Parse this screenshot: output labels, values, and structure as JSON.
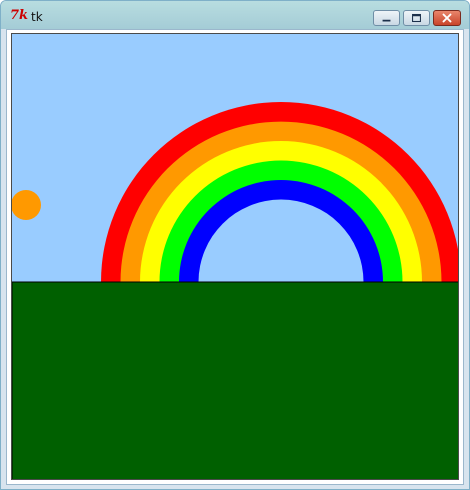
{
  "window": {
    "title": "tk",
    "logo_text": "7k",
    "controls": {
      "minimize_icon": "minimize-icon",
      "maximize_icon": "maximize-icon",
      "close_icon": "close-icon"
    }
  },
  "scene": {
    "sky_color": "#99ccff",
    "ground_color": "#006000",
    "sun_color": "#ff9900",
    "rainbow_bands": [
      "#ff0000",
      "#ff9900",
      "#ffff00",
      "#00ff00",
      "#0000ff"
    ]
  }
}
